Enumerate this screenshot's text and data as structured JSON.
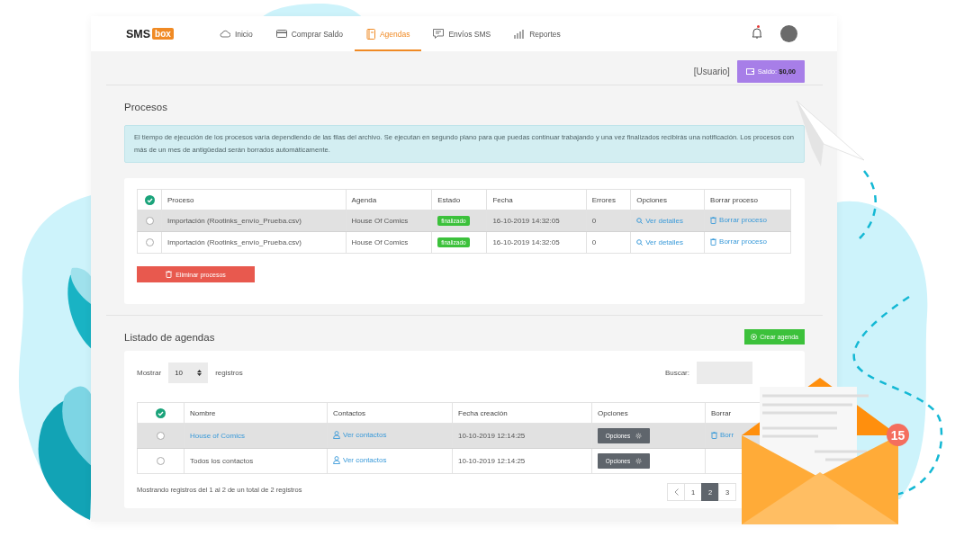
{
  "brand": {
    "name": "SMS",
    "tag": "box"
  },
  "nav": [
    {
      "label": "Inicio",
      "selected": false
    },
    {
      "label": "Comprar Saldo",
      "selected": false
    },
    {
      "label": "Agendas",
      "selected": true
    },
    {
      "label": "Envíos SMS",
      "selected": false
    },
    {
      "label": "Reportes",
      "selected": false
    }
  ],
  "notifications": {
    "unread": true
  },
  "user": {
    "name": "[Usuario]",
    "balance_button": "Saldo: **$0,00**"
  },
  "procesos": {
    "title": "Procesos",
    "notice": "El tiempo de ejecución de los procesos varía dependiendo de las filas del archivo. Se ejecutan en segundo plano para que puedas continuar trabajando y una vez finalizados recibirás una notificación. Los procesos con más de un mes de antigüedad serán borrados automáticamente.",
    "select_all_checked": true,
    "columns": [
      "Proceso",
      "Agenda",
      "Estado",
      "Fecha",
      "Errores",
      "Opciones",
      "Borrar proceso"
    ],
    "rows": [
      {
        "selected": false,
        "highlighted": true,
        "proceso": "Importación (Rootinks_envío_Prueba.csv)",
        "agenda": "House Of Comics",
        "estado": "finalizado",
        "fecha": "16-10-2019 14:32:05",
        "errores": "0",
        "opciones": "Ver detalles",
        "borrar": "Borrar proceso"
      },
      {
        "selected": false,
        "highlighted": false,
        "proceso": "Importación (Rootinks_envío_Prueba.csv)",
        "agenda": "House Of Comics",
        "estado": "finalizado",
        "fecha": "16-10-2019 14:32:05",
        "errores": "0",
        "opciones": "Ver detalles",
        "borrar": "Borrar proceso"
      }
    ],
    "delete_button": "Eliminar procesos"
  },
  "agendas": {
    "title": "Listado de agendas",
    "create_button": "Crear agenda",
    "show_label": "Mostrar",
    "page_size": "10",
    "records_label": "registros",
    "search_label": "Buscar:",
    "select_all_checked": true,
    "columns": [
      "Nombre",
      "Contactos",
      "Fecha creación",
      "Opciones",
      "Borrar"
    ],
    "rows": [
      {
        "selected": false,
        "highlighted": true,
        "link": true,
        "nombre": "House of Comics",
        "contactos": "Ver contactos",
        "fecha": "10-10-2019 12:14:25",
        "opciones": "Opciones",
        "borrar": "Borr"
      },
      {
        "selected": false,
        "highlighted": false,
        "link": false,
        "nombre": "Todos los contactos",
        "contactos": "Ver contactos",
        "fecha": "10-10-2019 12:14:25",
        "opciones": "Opciones"
      }
    ],
    "summary": "Mostrando registros del 1 al 2 de un total de 2 registros",
    "pages": [
      {
        "label": "1",
        "selected": false
      },
      {
        "label": "2",
        "selected": true
      },
      {
        "label": "3",
        "selected": false
      }
    ]
  },
  "envelope_badge": "15"
}
